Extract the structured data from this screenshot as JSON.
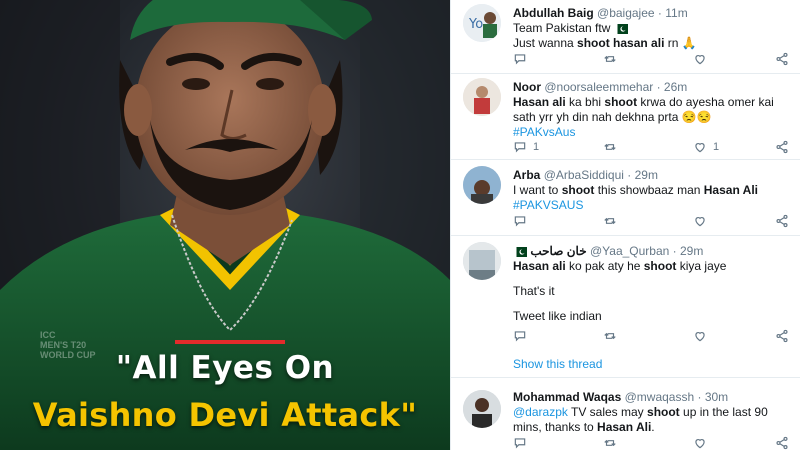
{
  "image_panel": {
    "headline_line1": "\"All Eyes On",
    "headline_line2": "Vaishno Devi Attack\"",
    "logo_text_1": "ICC",
    "logo_text_2": "MEN'S T20",
    "logo_text_3": "WORLD CUP",
    "accent_color": "#f5c400",
    "bar_color": "#e32b2b"
  },
  "tweets": [
    {
      "name": "Abdullah Baig",
      "handle": "@baigajee",
      "time": "11m",
      "line1": "Team Pakistan ftw",
      "line2_pre": "Just wanna ",
      "line2_bold1": "shoot hasan ali",
      "line2_post": " rn 🙏",
      "flag_icon": "pakistan-flag-icon"
    },
    {
      "name": "Noor",
      "handle": "@noorsaleemmehar",
      "time": "26m",
      "line1_b1": "Hasan ali",
      "line1_t1": " ka bhi ",
      "line1_b2": "shoot",
      "line1_t2": " krwa do ayesha omer kai",
      "line2": "sath yrr yh din nah dekhna prta 😒😒",
      "line3": "#PAKvsAus",
      "reply_count": "1",
      "like_count": "1"
    },
    {
      "name": "Arba",
      "handle": "@ArbaSiddiqui",
      "time": "29m",
      "line1_t1": "I want to ",
      "line1_b1": "shoot",
      "line1_t2": " this showbaaz man ",
      "line1_b2": "Hasan Ali",
      "line2": "#PAKVSAUS"
    },
    {
      "name": "خان صاحب",
      "handle": "@Yaa_Qurban",
      "time": "29m",
      "line1_b1": "Hasan ali",
      "line1_t1": " ko pak aty he ",
      "line1_b2": "shoot",
      "line1_t2": " kiya jaye",
      "line2": "That's it",
      "line3": "Tweet like indian",
      "show_thread": "Show this thread"
    },
    {
      "name": "Mohammad Waqas",
      "handle": "@mwaqassh",
      "time": "30m",
      "line1_m": "@darazpk",
      "line1_t1": " TV sales may ",
      "line1_b1": "shoot",
      "line1_t2": " up in the last 90",
      "line2_t1": "mins, thanks to ",
      "line2_b1": "Hasan Ali",
      "line2_t2": "."
    }
  ],
  "sep": " · ",
  "colors": {
    "link": "#1b95e0",
    "muted": "#657786",
    "text": "#14171a",
    "pak_green": "#01411c"
  }
}
